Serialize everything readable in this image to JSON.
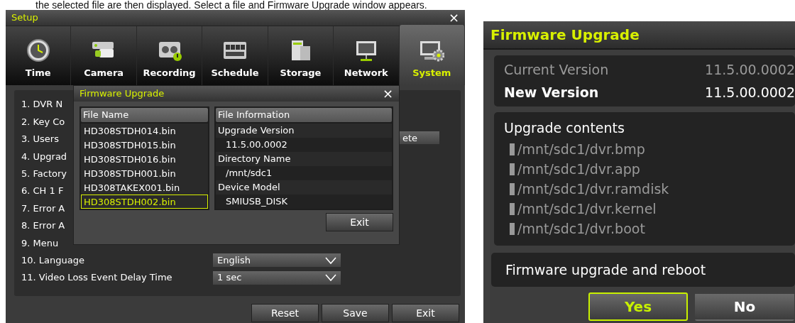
{
  "caption": "the selected file are then displayed. Select a file and Firmware Upgrade window appears.",
  "setup": {
    "title": "Setup",
    "close": "×",
    "tabs": [
      {
        "label": "Time",
        "selected": false
      },
      {
        "label": "Camera",
        "selected": false
      },
      {
        "label": "Recording",
        "selected": false
      },
      {
        "label": "Schedule",
        "selected": false
      },
      {
        "label": "Storage",
        "selected": false
      },
      {
        "label": "Network",
        "selected": false
      },
      {
        "label": "System",
        "selected": true
      }
    ],
    "settings": [
      {
        "label": "1. DVR N"
      },
      {
        "label": "2. Key Co"
      },
      {
        "label": "3. Users",
        "button": "ete"
      },
      {
        "label": "4. Upgrad"
      },
      {
        "label": "5. Factory"
      },
      {
        "label": "6. CH 1 F"
      },
      {
        "label": "7. Error A"
      },
      {
        "label": "8. Error A"
      },
      {
        "label": "9. Menu"
      },
      {
        "label": "10. Language",
        "value": "English"
      },
      {
        "label": "11. Video Loss Event Delay Time",
        "value": "1 sec"
      }
    ],
    "buttons": [
      "Reset",
      "Save",
      "Exit"
    ],
    "dialog": {
      "title": "Firmware Upgrade",
      "close": "×",
      "files_header": "File Name",
      "files": [
        {
          "name": "HD308STDH014.bin",
          "selected": false
        },
        {
          "name": "HD308STDH015.bin",
          "selected": false
        },
        {
          "name": "HD308STDH016.bin",
          "selected": false
        },
        {
          "name": "HD308STDH001.bin",
          "selected": false
        },
        {
          "name": "HD308TAKEX001.bin",
          "selected": false
        },
        {
          "name": "HD308STDH002.bin",
          "selected": true
        }
      ],
      "info_header": "File Information",
      "info": [
        {
          "label": "Upgrade Version",
          "value": "11.5.00.0002"
        },
        {
          "label": "Directory Name",
          "value": "/mnt/sdc1"
        },
        {
          "label": "Device Model",
          "value": "SMIUSB_DISK"
        }
      ],
      "exit": "Exit"
    }
  },
  "upgrade": {
    "title": "Firmware Upgrade",
    "versions": [
      {
        "label": "Current Version",
        "value": "11.5.00.0002",
        "disabled": true
      },
      {
        "label": "New Version",
        "value": "11.5.00.0002",
        "disabled": false
      }
    ],
    "contents_title": "Upgrade contents",
    "contents": [
      "/mnt/sdc1/dvr.bmp",
      "/mnt/sdc1/dvr.app",
      "/mnt/sdc1/dvr.ramdisk",
      "/mnt/sdc1/dvr.kernel",
      "/mnt/sdc1/dvr.boot"
    ],
    "prompt": "Firmware upgrade and reboot",
    "buttons": [
      {
        "label": "Yes",
        "selected": true
      },
      {
        "label": "No",
        "selected": false
      }
    ]
  }
}
